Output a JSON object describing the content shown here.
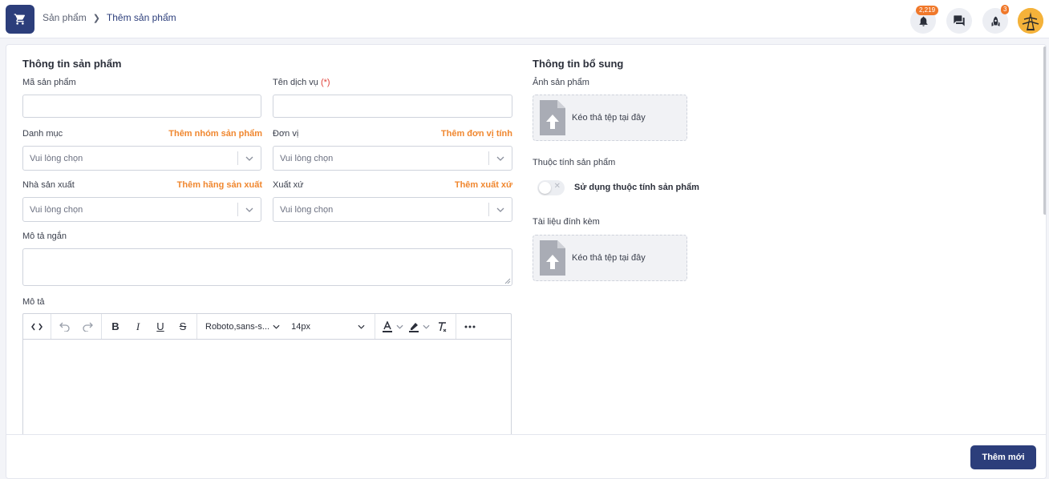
{
  "breadcrumb": {
    "parent": "Sản phẩm",
    "separator": "❯",
    "current": "Thêm sản phẩm"
  },
  "header": {
    "notifications_count": "2,219",
    "rocket_count": "3"
  },
  "product_info": {
    "title": "Thông tin sản phẩm",
    "code_label": "Mã sản phẩm",
    "service_name_label": "Tên dịch vụ",
    "required_mark": "(*)",
    "category_label": "Danh mục",
    "category_link": "Thêm nhóm sản phẩm",
    "category_placeholder": "Vui lòng chọn",
    "unit_label": "Đơn vị",
    "unit_link": "Thêm đơn vị tính",
    "unit_placeholder": "Vui lòng chọn",
    "manufacturer_label": "Nhà sản xuất",
    "manufacturer_link": "Thêm hãng sản xuất",
    "manufacturer_placeholder": "Vui lòng chọn",
    "origin_label": "Xuất xứ",
    "origin_link": "Thêm xuất xứ",
    "origin_placeholder": "Vui lòng chọn",
    "short_desc_label": "Mô tả ngắn",
    "desc_label": "Mô tả"
  },
  "editor": {
    "font_family": "Roboto,sans-s...",
    "font_size": "14px"
  },
  "extra_info": {
    "title": "Thông tin bổ sung",
    "image_label": "Ảnh sản phẩm",
    "dropzone_text": "Kéo thả tệp tại đây",
    "attributes_label": "Thuộc tính sản phẩm",
    "attributes_toggle_label": "Sử dụng thuộc tính sản phẩm",
    "attachments_label": "Tài liệu đính kèm",
    "attachments_dropzone_text": "Kéo thả tệp tại đây"
  },
  "footer": {
    "submit_label": "Thêm mới"
  },
  "colors": {
    "primary": "#2c3e7b",
    "accent_orange": "#f0872f",
    "required_red": "#e0423a"
  }
}
